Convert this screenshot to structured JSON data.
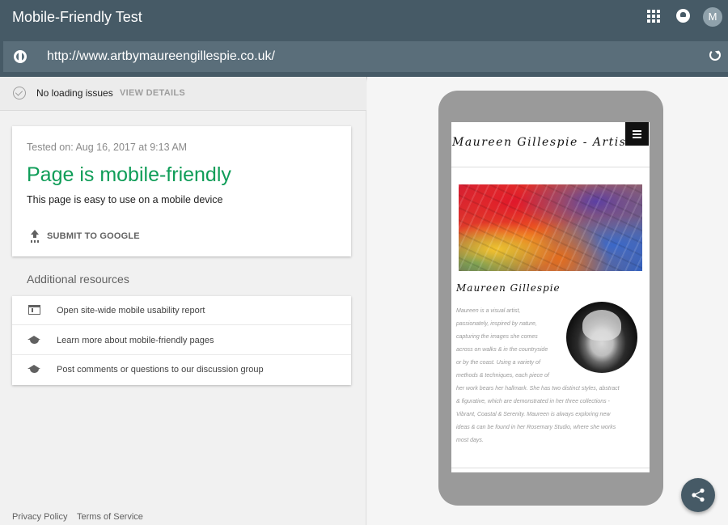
{
  "header": {
    "title": "Mobile-Friendly Test",
    "avatar_initial": "M",
    "url": "http://www.artbymaureengillespie.co.uk/"
  },
  "status": {
    "text": "No loading issues",
    "details_label": "VIEW DETAILS"
  },
  "result": {
    "tested_on": "Tested on: Aug 16, 2017 at 9:13 AM",
    "verdict": "Page is mobile-friendly",
    "verdict_sub": "This page is easy to use on a mobile device",
    "submit_label": "SUBMIT TO GOOGLE",
    "verdict_color": "#0f9d58"
  },
  "resources": {
    "title": "Additional resources",
    "items": [
      {
        "label": "Open site-wide mobile usability report",
        "icon": "web-icon"
      },
      {
        "label": "Learn more about mobile-friendly pages",
        "icon": "school-icon"
      },
      {
        "label": "Post comments or questions to our discussion group",
        "icon": "school-icon"
      }
    ]
  },
  "footer": {
    "privacy": "Privacy Policy",
    "terms": "Terms of Service"
  },
  "preview": {
    "site_title": "Maureen Gillespie - Artist",
    "artist_heading": "Maureen Gillespie",
    "bio_lines": [
      "Maureen is a visual artist,",
      "passionately, inspired by nature,",
      "capturing the images she comes",
      "across on walks & in the countryside",
      "or by the coast. Using a variety of",
      "methods & techniques, each piece of",
      "her work bears her hallmark. She has two distinct styles, abstract",
      "& figurative, which are demonstrated in her three collections -",
      "Vibrant, Coastal & Serenity. Maureen is always exploring new",
      "ideas & can be found in her Rosemary Studio, where she works",
      "most days."
    ]
  },
  "colors": {
    "header_bg": "#465a66",
    "urlbar_bg": "#5a6e7a",
    "accent_green": "#0f9d58"
  }
}
